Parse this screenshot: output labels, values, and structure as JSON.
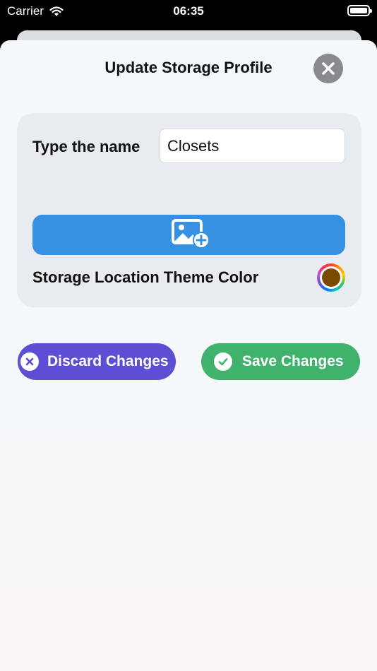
{
  "status_bar": {
    "carrier": "Carrier",
    "time": "06:35"
  },
  "sheet": {
    "title": "Update Storage Profile"
  },
  "form": {
    "name_label": "Type the name",
    "name_value": "Closets",
    "theme_color_label": "Storage Location Theme Color",
    "theme_color_value": "#7a4a00"
  },
  "actions": {
    "discard_label": "Discard Changes",
    "save_label": "Save Changes"
  },
  "colors": {
    "image_button": "#3691e3",
    "discard_button": "#5c4fd3",
    "save_button": "#3fb26b",
    "close_button": "#8a8a8e"
  },
  "icons": {
    "close": "xmark-icon",
    "add_image": "photo-badge-plus-icon",
    "discard": "xmark-circle-icon",
    "save": "checkmark-circle-icon",
    "wifi": "wifi-icon",
    "battery": "battery-icon"
  }
}
